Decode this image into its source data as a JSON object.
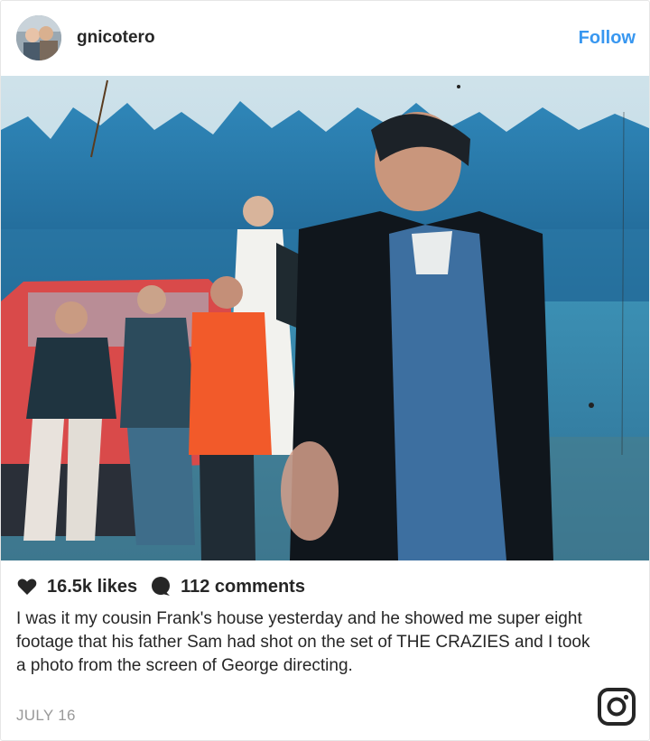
{
  "header": {
    "username": "gnicotero",
    "follow_label": "Follow"
  },
  "photo": {
    "description_icon": "post-photo"
  },
  "stats": {
    "likes": "16.5k likes",
    "comments": "112 comments"
  },
  "caption": "I was it my cousin Frank's house yesterday and he showed me super eight footage that his father Sam had shot on the set of THE CRAZIES and I took a photo from the screen of George directing.",
  "date": "JULY 16",
  "colors": {
    "accent": "#3897f0",
    "text": "#262626",
    "muted": "#999999"
  },
  "icons": [
    "heart-icon",
    "comment-bubble-icon",
    "instagram-logo-icon"
  ]
}
